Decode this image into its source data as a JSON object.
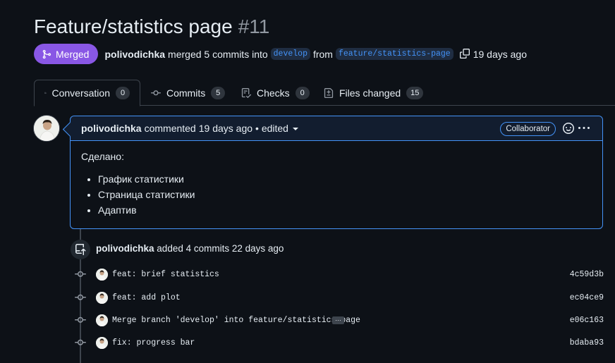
{
  "header": {
    "title": "Feature/statistics page",
    "number": "#11"
  },
  "meta": {
    "state": "Merged",
    "author": "polivodichka",
    "merged_text": "merged 5 commits into",
    "base_branch": "develop",
    "from_text": "from",
    "head_branch": "feature/statistics-page",
    "ago": "19 days ago"
  },
  "tabs": [
    {
      "label": "Conversation",
      "count": "0",
      "icon": "comment-discussion-icon"
    },
    {
      "label": "Commits",
      "count": "5",
      "icon": "git-commit-icon"
    },
    {
      "label": "Checks",
      "count": "0",
      "icon": "checklist-icon"
    },
    {
      "label": "Files changed",
      "count": "15",
      "icon": "file-diff-icon"
    }
  ],
  "comment": {
    "author": "polivodichka",
    "action": "commented",
    "ago": "19 days ago",
    "edited": "• edited",
    "role_badge": "Collaborator",
    "body_intro": "Сделано:",
    "items": [
      "График статистики",
      "Страница статистики",
      "Адаптив"
    ]
  },
  "event": {
    "author": "polivodichka",
    "text": "added 4 commits",
    "ago": "22 days ago"
  },
  "commits": [
    {
      "message": "feat: brief statistics",
      "sha": "4c59d3b"
    },
    {
      "message": "feat: add plot",
      "sha": "ec04ce9"
    },
    {
      "message": "Merge branch 'develop' into feature/statistics-page",
      "sha": "e06c163"
    },
    {
      "message": "fix: progress bar",
      "sha": "bdaba93"
    }
  ],
  "colors": {
    "background": "#0d1117",
    "merged": "#8957e5",
    "accent": "#4493f8",
    "border": "#3d444d"
  }
}
